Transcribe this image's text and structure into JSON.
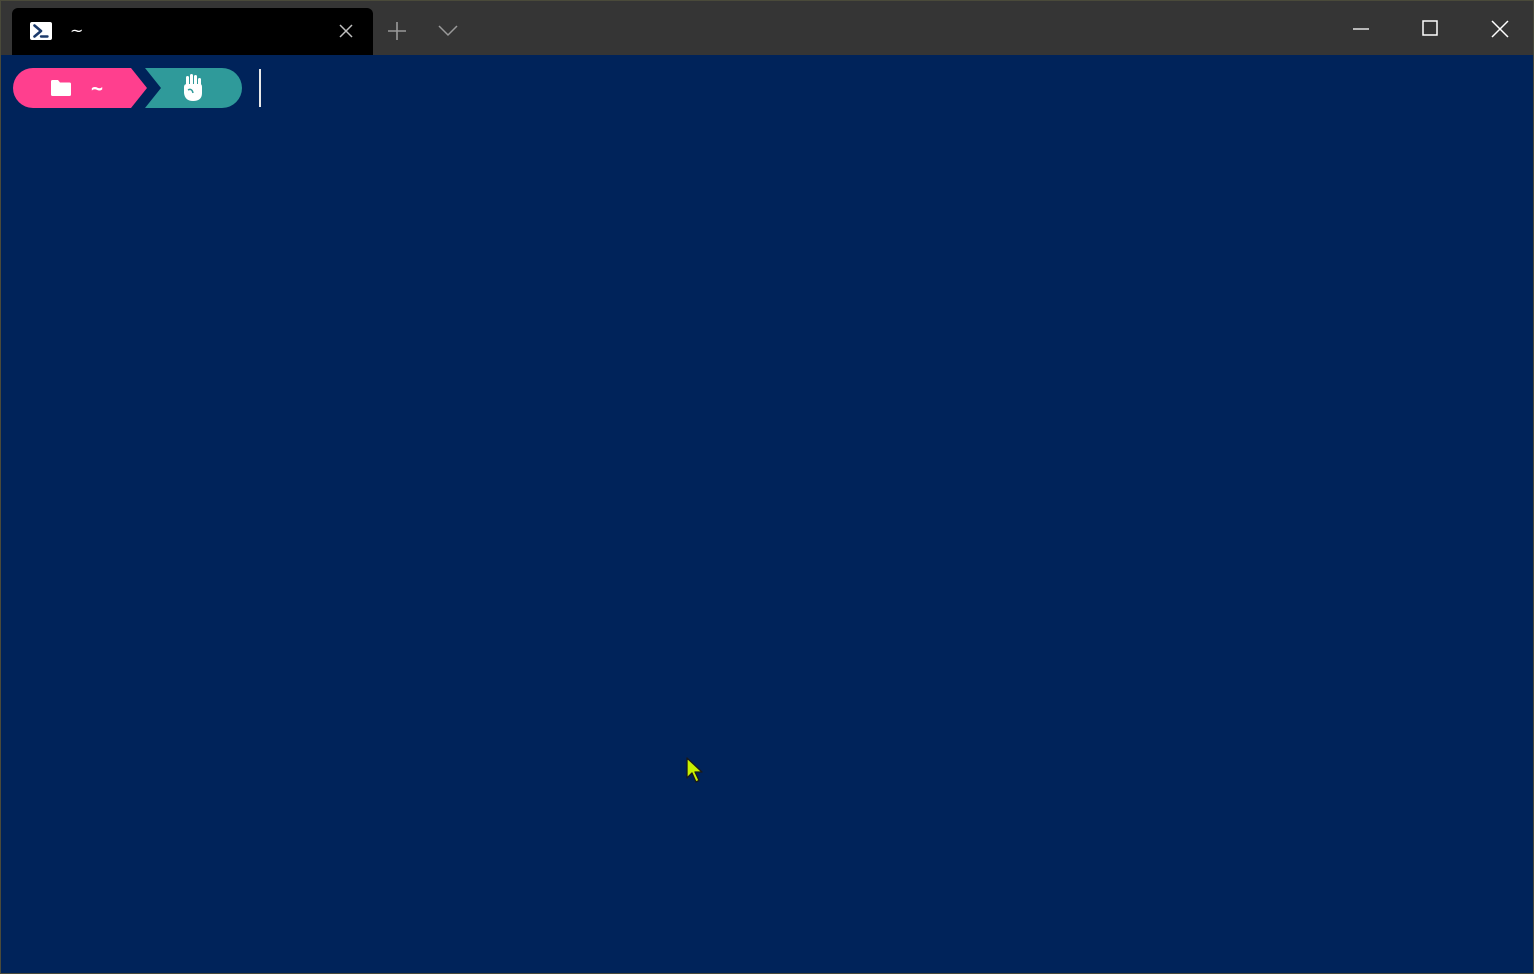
{
  "window": {
    "tab": {
      "title": "~",
      "icon": "powershell-icon",
      "close_icon": "close-icon"
    },
    "new_tab_icon": "plus-icon",
    "dropdown_icon": "chevron-down-icon",
    "controls": {
      "minimize_icon": "minimize-icon",
      "maximize_icon": "maximize-icon",
      "close_icon": "close-icon"
    }
  },
  "terminal": {
    "prompt": {
      "path_icon": "folder-icon",
      "path": "~",
      "admin_icon": "hand-icon"
    }
  },
  "colors": {
    "background": "#00235a",
    "titlebar": "#353535",
    "tab": "#000000",
    "prompt_path": "#ff3f8e",
    "prompt_admin": "#2f9a9a",
    "mouse_pointer": "#c8f000"
  }
}
